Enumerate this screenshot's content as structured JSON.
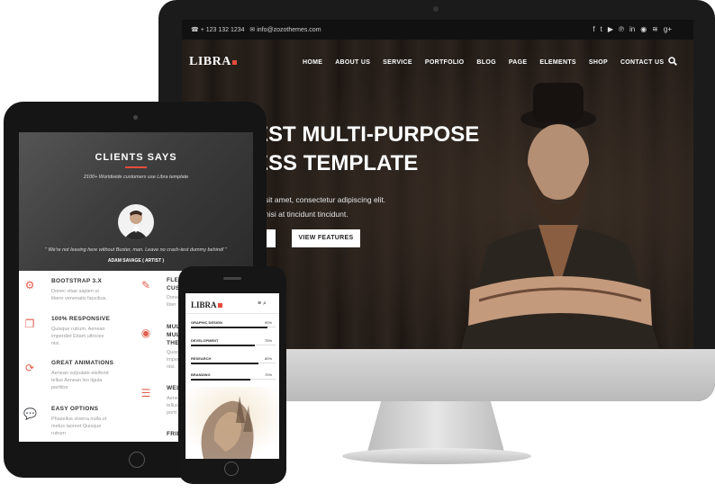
{
  "imac": {
    "contact_phone": "+ 123 132 1234",
    "contact_email": "info@zozothemes.com",
    "social_icons": [
      "f",
      "t",
      "yt",
      "p",
      "in",
      "gh",
      "rss",
      "g+"
    ],
    "logo": "LIBRA",
    "nav": [
      "HOME",
      "ABOUT US",
      "SERVICE",
      "PORTFOLIO",
      "BLOG",
      "PAGE",
      "ELEMENTS",
      "SHOP",
      "CONTACT US"
    ],
    "hero_title": "EST MULTI-PURPOSE\nESS TEMPLATE",
    "hero_sub": "sit amet, consectetur adipiscing elit.\nnisi at tincidunt tincidunt.",
    "button": "VIEW FEATURES"
  },
  "ipad": {
    "clients_title": "CLIENTS SAYS",
    "clients_sub": "2100+ Worldwide customers use Libra template",
    "quote": "\" We're not leaving here without Buster, man. Leave no crash-test dummy behind! \"",
    "name": "ADAM SAVAGE ( ARTIST )",
    "features_left": [
      {
        "title": "BOOTSTRAP 3.X",
        "desc": "Donec vitae sapien ut\nlibero venenatis faucibus."
      },
      {
        "title": "100% RESPONSIVE",
        "desc": "Quisque rutrum. Aenean\nimperdiet Etiam ultricies\nnisi."
      },
      {
        "title": "GREAT ANIMATIONS",
        "desc": "Aenean vulputate eleifend\ntellus Aenean leo ligula\nporttitor"
      },
      {
        "title": "EASY OPTIONS",
        "desc": "Phasellus viverra nulla ut\nmetus laoreet Quisque\nrutrum"
      }
    ],
    "features_right": [
      {
        "title": "FLEX\nCUST",
        "desc": "Done\nliber"
      },
      {
        "title": "MULT\nMULTI\nTHEM",
        "desc": "Quisq\nimper\nnisi."
      },
      {
        "title": "WEL",
        "desc": "Aene\ntellus\nportt"
      },
      {
        "title": "FRIE",
        "desc": ""
      }
    ]
  },
  "phone": {
    "logo": "LIBRA",
    "menu_icons": "≡  ⌕",
    "bars": [
      {
        "label": "GRAPHIC DESIGN",
        "pct": "90%",
        "value": 0.9
      },
      {
        "label": "DEVELOPMENT",
        "pct": "75%",
        "value": 0.75
      },
      {
        "label": "RESEARCH",
        "pct": "80%",
        "value": 0.8
      },
      {
        "label": "BRANDING",
        "pct": "70%",
        "value": 0.7
      }
    ]
  }
}
